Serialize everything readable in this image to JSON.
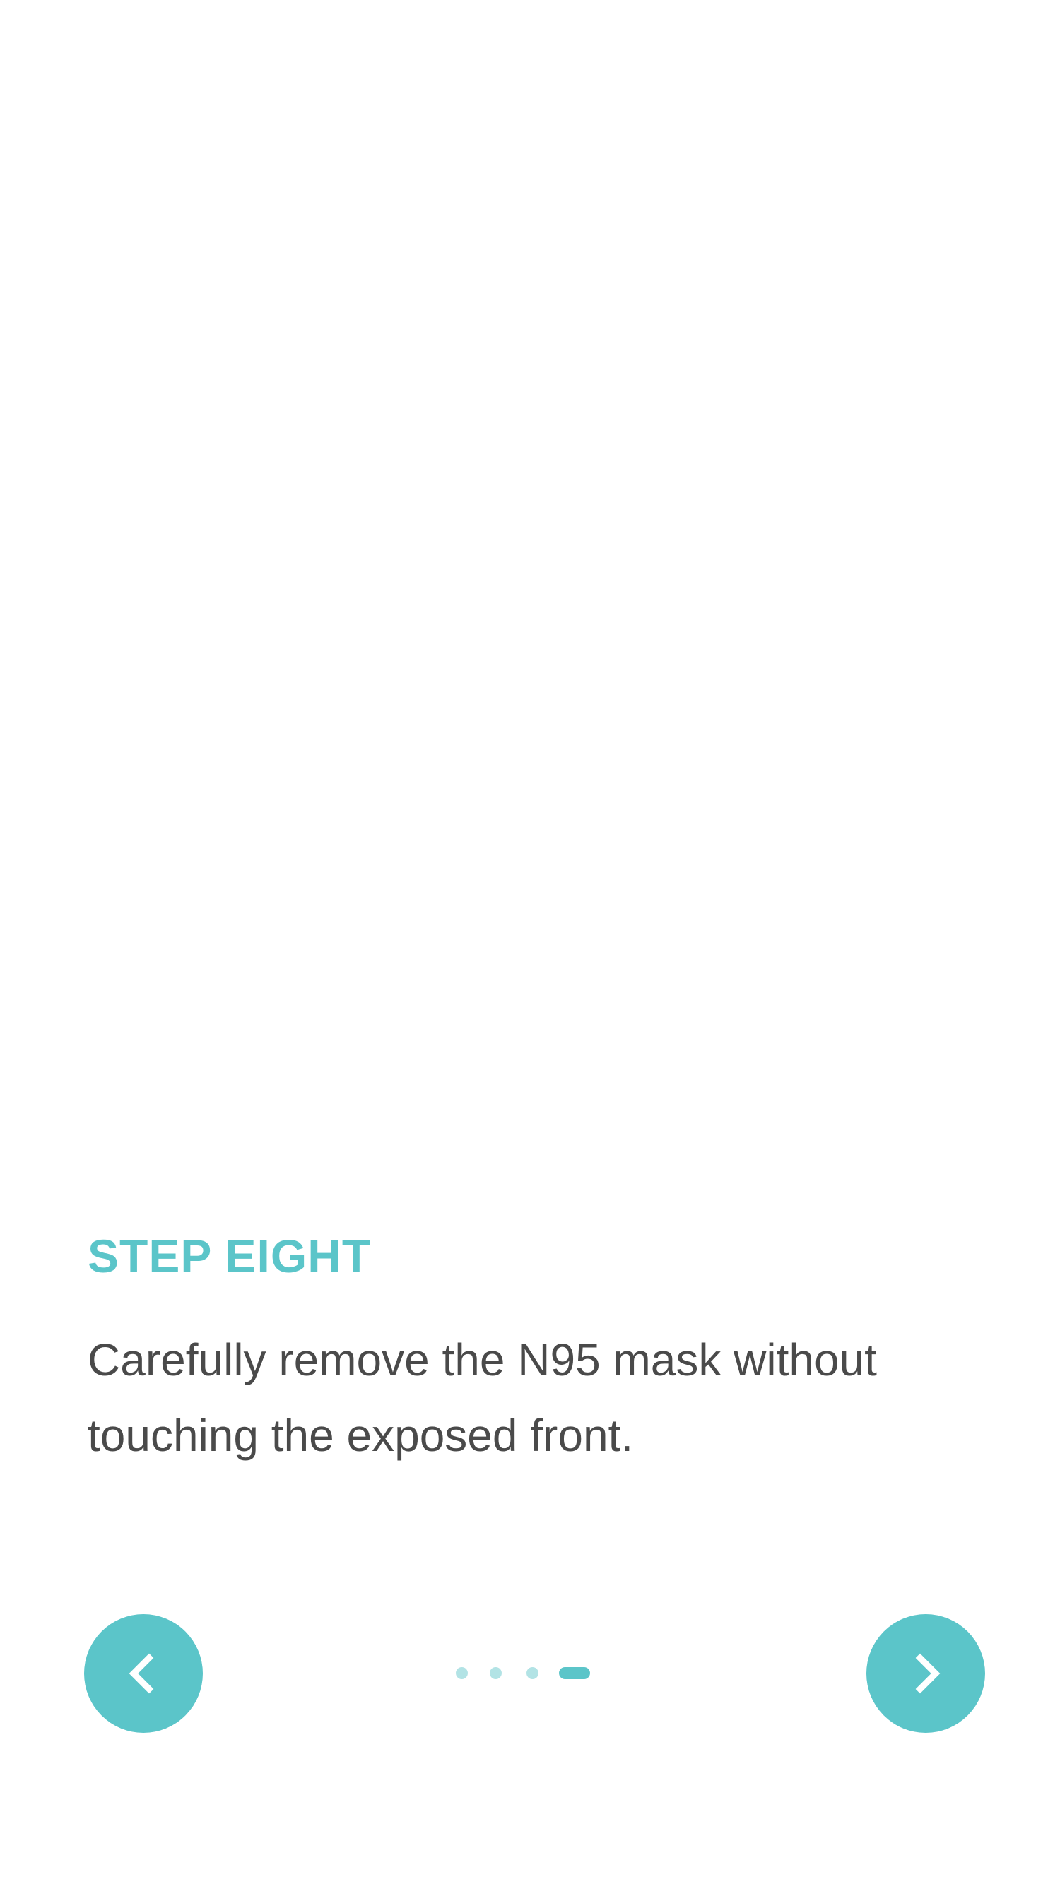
{
  "step": {
    "title": "STEP EIGHT",
    "description": "Carefully remove the N95 mask without touching the exposed front."
  },
  "navigation": {
    "prev_icon": "chevron-left-icon",
    "next_icon": "chevron-right-icon"
  },
  "pager": {
    "total_visible_dots": 4,
    "active_index": 3
  },
  "colors": {
    "accent": "#5bc5c9",
    "accent_light": "#b2e3e5",
    "text": "#4a4a4a",
    "background": "#ffffff"
  }
}
